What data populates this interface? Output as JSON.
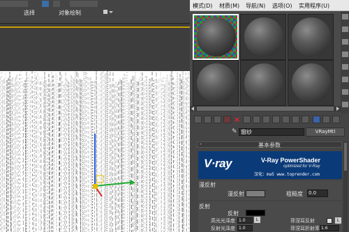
{
  "toolbar_left": {
    "select_label": "选择",
    "object_paint_label": "对象绘制"
  },
  "menu": {
    "items": [
      "模式(D)",
      "材质(M)",
      "导航(N)",
      "选项(O)",
      "实用程序(U)"
    ]
  },
  "material": {
    "name": "窗纱",
    "type": "VRayMtl"
  },
  "rollout": {
    "title": "基本参数",
    "toggle": "-"
  },
  "banner": {
    "logo": "V·ray",
    "title": "V-Ray PowerShader",
    "subtitle": "optimized for V-Ray",
    "credit": "汉化：ma5  www.toprender.com"
  },
  "diffuse": {
    "section": "漫反射",
    "label": "漫反射",
    "roughness_label": "粗糙度",
    "roughness_value": "0.0"
  },
  "reflection": {
    "section": "反射",
    "label": "反射",
    "hilight_label": "高光光泽度",
    "hilight_value": "1.0",
    "lock": "L",
    "fresnel_label": "菲涅耳反射",
    "refl_gloss_label": "反射光泽度",
    "refl_gloss_value": "1.0",
    "fresnel_ior_label": "菲涅耳折射率",
    "fresnel_ior_value": "1.6"
  },
  "colors": {
    "viewport_line": "#c8a000",
    "banner_blue": "#0b3a78",
    "menubar": "#e8e8e8"
  }
}
